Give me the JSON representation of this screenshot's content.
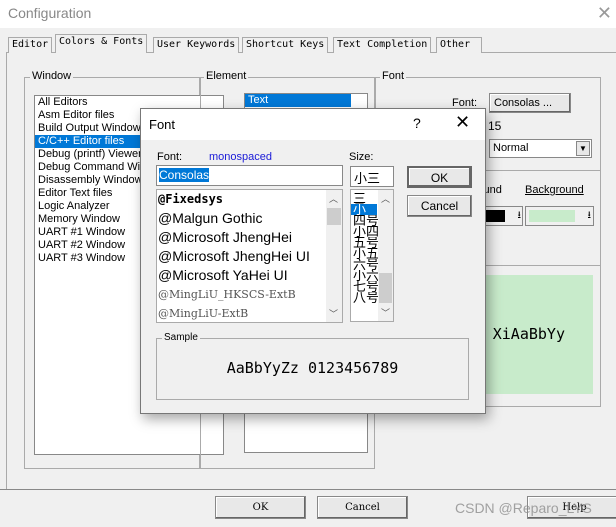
{
  "window": {
    "title": "Configuration",
    "close_icon": "close-icon"
  },
  "tabs": [
    "Editor",
    "Colors & Fonts",
    "User Keywords",
    "Shortcut Keys",
    "Text Completion",
    "Other"
  ],
  "window_group": {
    "label": "Window",
    "items": [
      "All Editors",
      "Asm Editor files",
      "Build Output Window",
      "C/C++ Editor files",
      "Debug (printf) Viewer",
      "Debug Command Window",
      "Disassembly Window",
      "Editor Text files",
      "Logic Analyzer",
      "Memory Window",
      "UART #1 Window",
      "UART #2 Window",
      "UART #3 Window"
    ],
    "selected": "C/C++ Editor files"
  },
  "element_group": {
    "label": "Element",
    "items": [
      "Text"
    ],
    "selected": "Text"
  },
  "font_group": {
    "label": "Font",
    "font_label": "Font:",
    "font_button": "Consolas ...",
    "size": "15",
    "style": "Normal",
    "foreground_label": "Foreground",
    "background_label": "Background",
    "foreground_color": "#000000",
    "background_color": "#c8ebcb",
    "preview": "XiAaBbYy"
  },
  "buttons": {
    "ok": "OK",
    "cancel": "Cancel",
    "help": "Help"
  },
  "font_dialog": {
    "title": "Font",
    "help": "?",
    "font_label": "Font:",
    "font_type": "monospaced",
    "font_value": "Consolas",
    "fonts": [
      "@Fixedsys",
      "@Malgun Gothic",
      "@Microsoft JhengHei",
      "@Microsoft JhengHei UI",
      "@Microsoft YaHei UI",
      "@MingLiU_HKSCS-ExtB",
      "@MingLiU-ExtB"
    ],
    "size_label": "Size:",
    "size_value": "小三",
    "sizes": [
      "三号",
      "小三",
      "四号",
      "小四",
      "五号",
      "小五",
      "六号",
      "小六",
      "七号",
      "八号"
    ],
    "selected_size": "小三",
    "ok": "OK",
    "cancel": "Cancel",
    "sample_label": "Sample",
    "sample_text": "AaBbYyZz 0123456789"
  },
  "watermark": "CSDN @Reparo_LYS"
}
